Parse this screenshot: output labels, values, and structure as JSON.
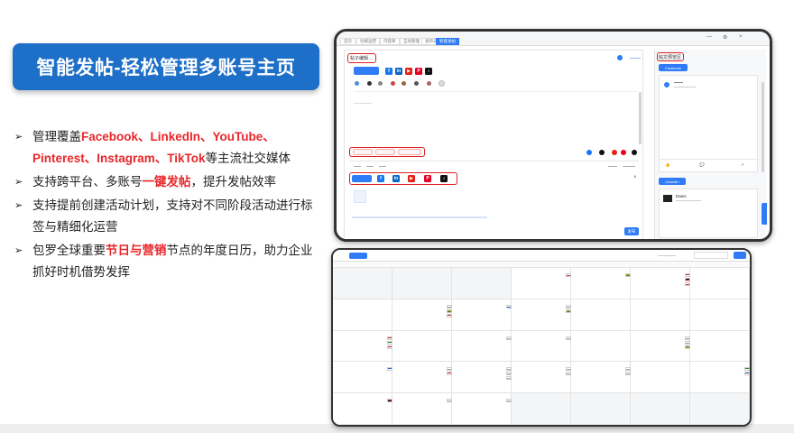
{
  "title": "智能发帖-轻松管理多账号主页",
  "bullets": [
    {
      "parts": [
        {
          "text": "管理覆盖",
          "red": false
        },
        {
          "text": "Facebook、LinkedIn、YouTube、Pinterest、Instagram、TikTok",
          "red": true
        },
        {
          "text": "等主流社交媒体",
          "red": false
        }
      ]
    },
    {
      "parts": [
        {
          "text": "支持跨平台、多账号",
          "red": false
        },
        {
          "text": "一键发帖",
          "red": true
        },
        {
          "text": "，提升发帖效率",
          "red": false
        }
      ]
    },
    {
      "parts": [
        {
          "text": "支持提前创建活动计划，支持对不同阶段活动进行标签与精细化运营",
          "red": false
        }
      ]
    },
    {
      "parts": [
        {
          "text": "包罗全球重要",
          "red": false
        },
        {
          "text": "节日与营销",
          "red": true
        },
        {
          "text": "节点的年度日历，助力企业抓好时机借势发挥",
          "red": false
        }
      ]
    }
  ],
  "compose_window": {
    "tabs": [
      "首页",
      "社媒运营",
      "内容库",
      "互动管理",
      "发布日历",
      "智能发帖"
    ],
    "panel_title": "帖子编辑",
    "preview_title": "帖文预览区",
    "preview_channels": [
      "Facebook",
      "LinkedIn"
    ],
    "preview_accounts": [
      "Danis"
    ],
    "publish_button": "发布",
    "platform_icons": [
      "f",
      "in",
      "▶",
      "P",
      "♪"
    ]
  },
  "calendar": {
    "day_numbers": [
      [
        "",
        "",
        "",
        "",
        "",
        "",
        ""
      ],
      [
        "",
        "",
        "",
        "",
        "",
        "",
        ""
      ],
      [
        "",
        "",
        "",
        "",
        "",
        "",
        ""
      ],
      [
        "",
        "",
        "",
        "",
        "",
        "",
        ""
      ],
      [
        "",
        "",
        "",
        "",
        "",
        "",
        ""
      ]
    ]
  },
  "colors": {
    "banner": "#1e6fc8",
    "accent": "#2f7cf6",
    "highlight_red": "#e8262a"
  }
}
